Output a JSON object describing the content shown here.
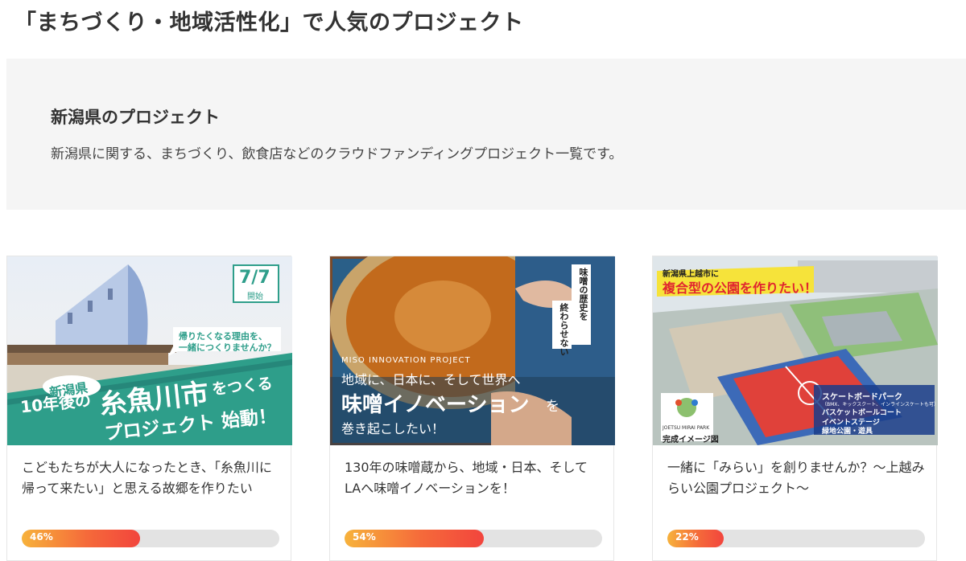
{
  "page": {
    "title": "「まちづくり・地域活性化」で人気のプロジェクト"
  },
  "info": {
    "heading": "新潟県のプロジェクト",
    "description": "新潟県に関する、まちづくり、飲食店などのクラウドファンディングプロジェクト一覧です。"
  },
  "cards": [
    {
      "title": "こどもたちが大人になったとき、「糸魚川に帰って来たい」と思える故郷を作りたい",
      "progress_label": "46%",
      "progress_value": 0.46,
      "image": {
        "start_badge_date": "7/7",
        "start_badge_label": "開始",
        "bubble_line1": "帰りたくなる理由を、",
        "bubble_line2": "一緒につくりませんか？",
        "prefecture": "新潟県",
        "line2_small": "10年後の",
        "line2_big": "糸魚川市",
        "line2_tail": "をつくる",
        "line3": "プロジェクト 始動！"
      }
    },
    {
      "title": "130年の味噌蔵から、地域・日本、そしてLAへ味噌イノベーションを！",
      "progress_label": "54%",
      "progress_value": 0.54,
      "image": {
        "vertical_a": "味噌の歴史を",
        "vertical_b": "終わらせない",
        "eng_label": "MISO INNOVATION PROJECT",
        "line1": "地域に、日本に、そして世界へ",
        "line2_big": "味噌イノベーション",
        "line2_tail": "を",
        "line3": "巻き起こしたい！"
      }
    },
    {
      "title": "一緒に「みらい」を創りませんか？～上越みらい公園プロジェクト～",
      "progress_label": "22%",
      "progress_value": 0.22,
      "image": {
        "sub": "新潟県上越市に",
        "main": "複合型の公園を作りたい！",
        "park_name": "JOETSU MIRAI PARK",
        "caption": "完成イメージ図",
        "legend1": "スケートボードパーク",
        "legend1_sub": "（BMX、キックスクート、インラインスケートも可）",
        "legend2": "バスケットボールコート",
        "legend3": "イベントステージ",
        "legend4": "緑地公園・遊具"
      }
    }
  ],
  "colors": {
    "accent_gradient_start": "#f7b23b",
    "accent_gradient_end": "#f2453d",
    "track": "#e3e3e3",
    "info_bg": "#f5f5f5"
  }
}
